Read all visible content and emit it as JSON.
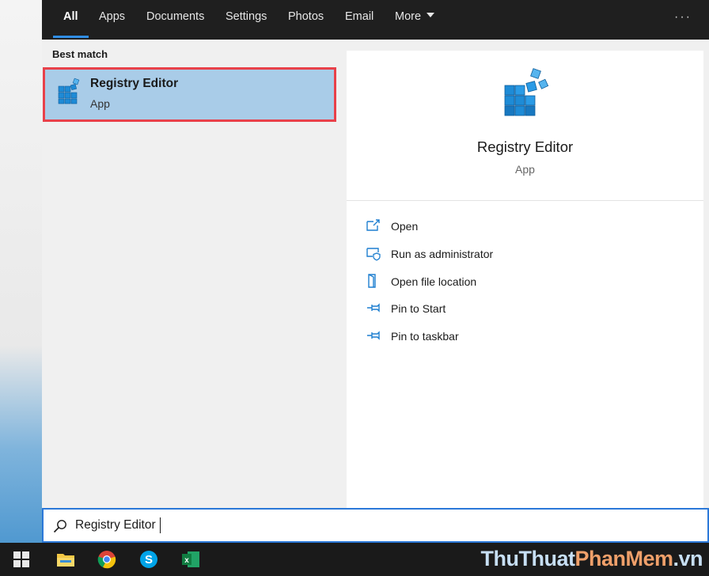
{
  "tabs": [
    {
      "label": "All",
      "active": true
    },
    {
      "label": "Apps"
    },
    {
      "label": "Documents"
    },
    {
      "label": "Settings"
    },
    {
      "label": "Photos"
    },
    {
      "label": "Email"
    },
    {
      "label": "More"
    }
  ],
  "more_menu_icon": "ellipsis-icon",
  "best_match": {
    "heading": "Best match",
    "title": "Registry Editor",
    "subtitle": "App",
    "icon": "registry-editor-icon"
  },
  "detail": {
    "title": "Registry Editor",
    "subtitle": "App",
    "actions": [
      {
        "label": "Open",
        "icon": "open-icon"
      },
      {
        "label": "Run as administrator",
        "icon": "shield-icon"
      },
      {
        "label": "Open file location",
        "icon": "folder-location-icon"
      },
      {
        "label": "Pin to Start",
        "icon": "pin-icon"
      },
      {
        "label": "Pin to taskbar",
        "icon": "pin-icon"
      }
    ]
  },
  "search": {
    "value": "Registry Editor",
    "icon": "search-icon"
  },
  "taskbar": {
    "items": [
      "windows-start-icon",
      "file-explorer-icon",
      "chrome-icon",
      "skype-icon",
      "excel-icon"
    ]
  },
  "watermark": {
    "part1": "ThuThuat",
    "part2": "PhanMem",
    "part3": ".vn"
  },
  "colors": {
    "accent": "#2b78d8",
    "selection": "#a9cce8",
    "highlight_border": "#e8414a",
    "icon_blue": "#1e8bd6"
  }
}
